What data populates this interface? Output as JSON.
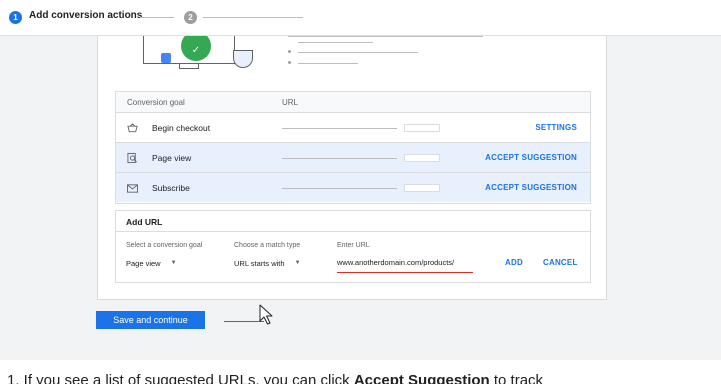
{
  "stepper": {
    "step1": {
      "number": "1",
      "label": "Add conversion actions"
    },
    "step2": {
      "number": "2"
    }
  },
  "table": {
    "headers": {
      "goal": "Conversion goal",
      "url": "URL"
    },
    "rows": [
      {
        "icon": "basket-icon",
        "label": "Begin checkout",
        "action": "SETTINGS",
        "highlighted": false
      },
      {
        "icon": "page-view-icon",
        "label": "Page view",
        "action": "ACCEPT SUGGESTION",
        "highlighted": true
      },
      {
        "icon": "envelope-icon",
        "label": "Subscribe",
        "action": "ACCEPT SUGGESTION",
        "highlighted": true
      }
    ]
  },
  "add_url": {
    "title": "Add URL",
    "goal_label": "Select a conversion goal",
    "goal_value": "Page view",
    "match_label": "Choose a match type",
    "match_value": "URL starts with",
    "url_label": "Enter URL",
    "url_value": "www.anotherdomain.com/products/",
    "add": "ADD",
    "cancel": "CANCEL"
  },
  "save_button": "Save and continue",
  "caption": {
    "prefix": "1. If you see a list of suggested URLs, you can click ",
    "bold": "Accept Suggestion",
    "suffix": " to track"
  },
  "colors": {
    "accent": "#1a73e8",
    "highlight_row": "#e8f0fe",
    "error_underline": "#d93025",
    "check": "#34a853"
  }
}
